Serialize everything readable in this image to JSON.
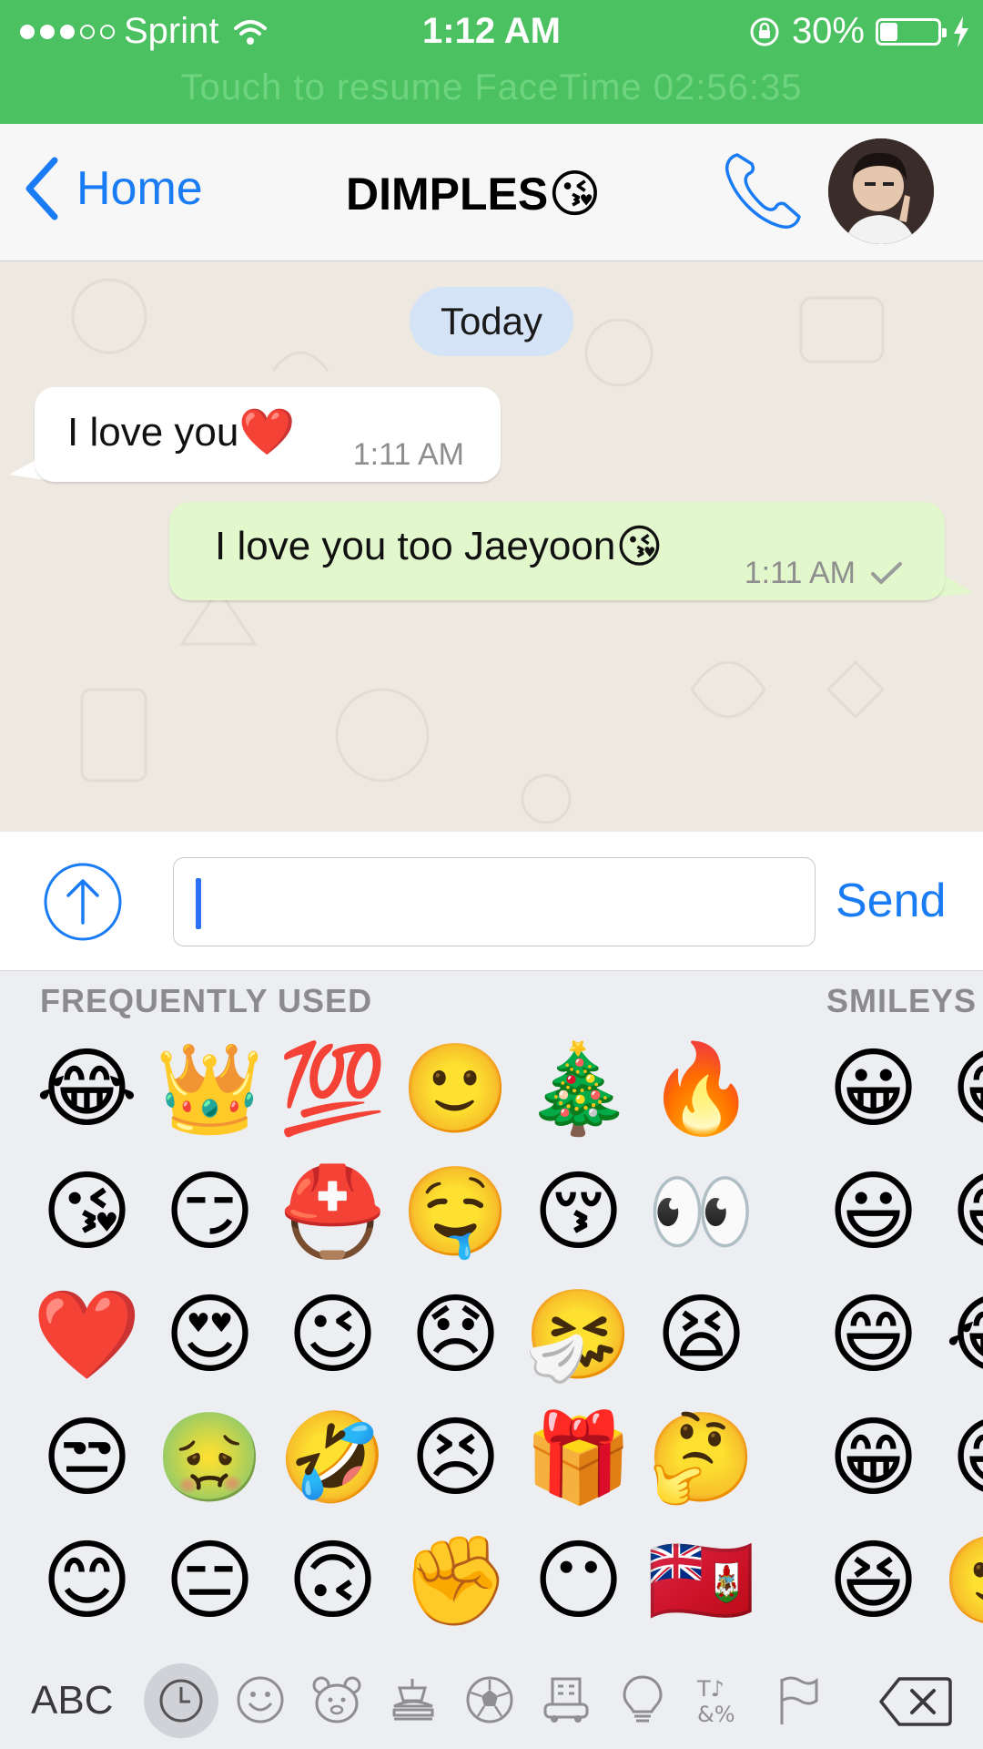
{
  "status": {
    "carrier": "Sprint",
    "time": "1:12 AM",
    "battery": "30%",
    "battery_level": 0.3,
    "resume_banner": "Touch to resume FaceTime 02:56:35"
  },
  "nav": {
    "back_label": "Home",
    "title": "DIMPLES",
    "title_emoji": "😘"
  },
  "chat": {
    "date_label": "Today",
    "messages": [
      {
        "direction": "incoming",
        "text": "I love you",
        "emoji": "❤️",
        "time": "1:11 AM"
      },
      {
        "direction": "outgoing",
        "text": "I love you too Jaeyoon",
        "emoji": "😘",
        "time": "1:11 AM",
        "status": "sent"
      }
    ]
  },
  "composer": {
    "value": "",
    "send_label": "Send"
  },
  "keyboard": {
    "section_frequent": "FREQUENTLY USED",
    "section_smileys": "SMILEYS",
    "frequent": [
      "😂",
      "👑",
      "💯",
      "🙂",
      "🎄",
      "🔥",
      "😘",
      "😏",
      "⛑️",
      "🤤",
      "😚",
      "👀",
      "❤️",
      "😍",
      "😉",
      "😞",
      "🤧",
      "😫",
      "😒",
      "🤢",
      "🤣",
      "😣",
      "🎁",
      "🤔",
      "😊",
      "😑",
      "🙃",
      "✊",
      "😶",
      "🇧🇲"
    ],
    "smileys": [
      "😀",
      "😁",
      "😃",
      "😅",
      "😄",
      "😂",
      "😁",
      "😅",
      "😆",
      "🙂"
    ],
    "abc_label": "ABC",
    "categories": [
      "recent-clock-icon",
      "smiley-icon",
      "animal-icon",
      "food-icon",
      "sport-ball-icon",
      "travel-icon",
      "object-bulb-icon",
      "symbols-icon",
      "flag-icon"
    ]
  }
}
